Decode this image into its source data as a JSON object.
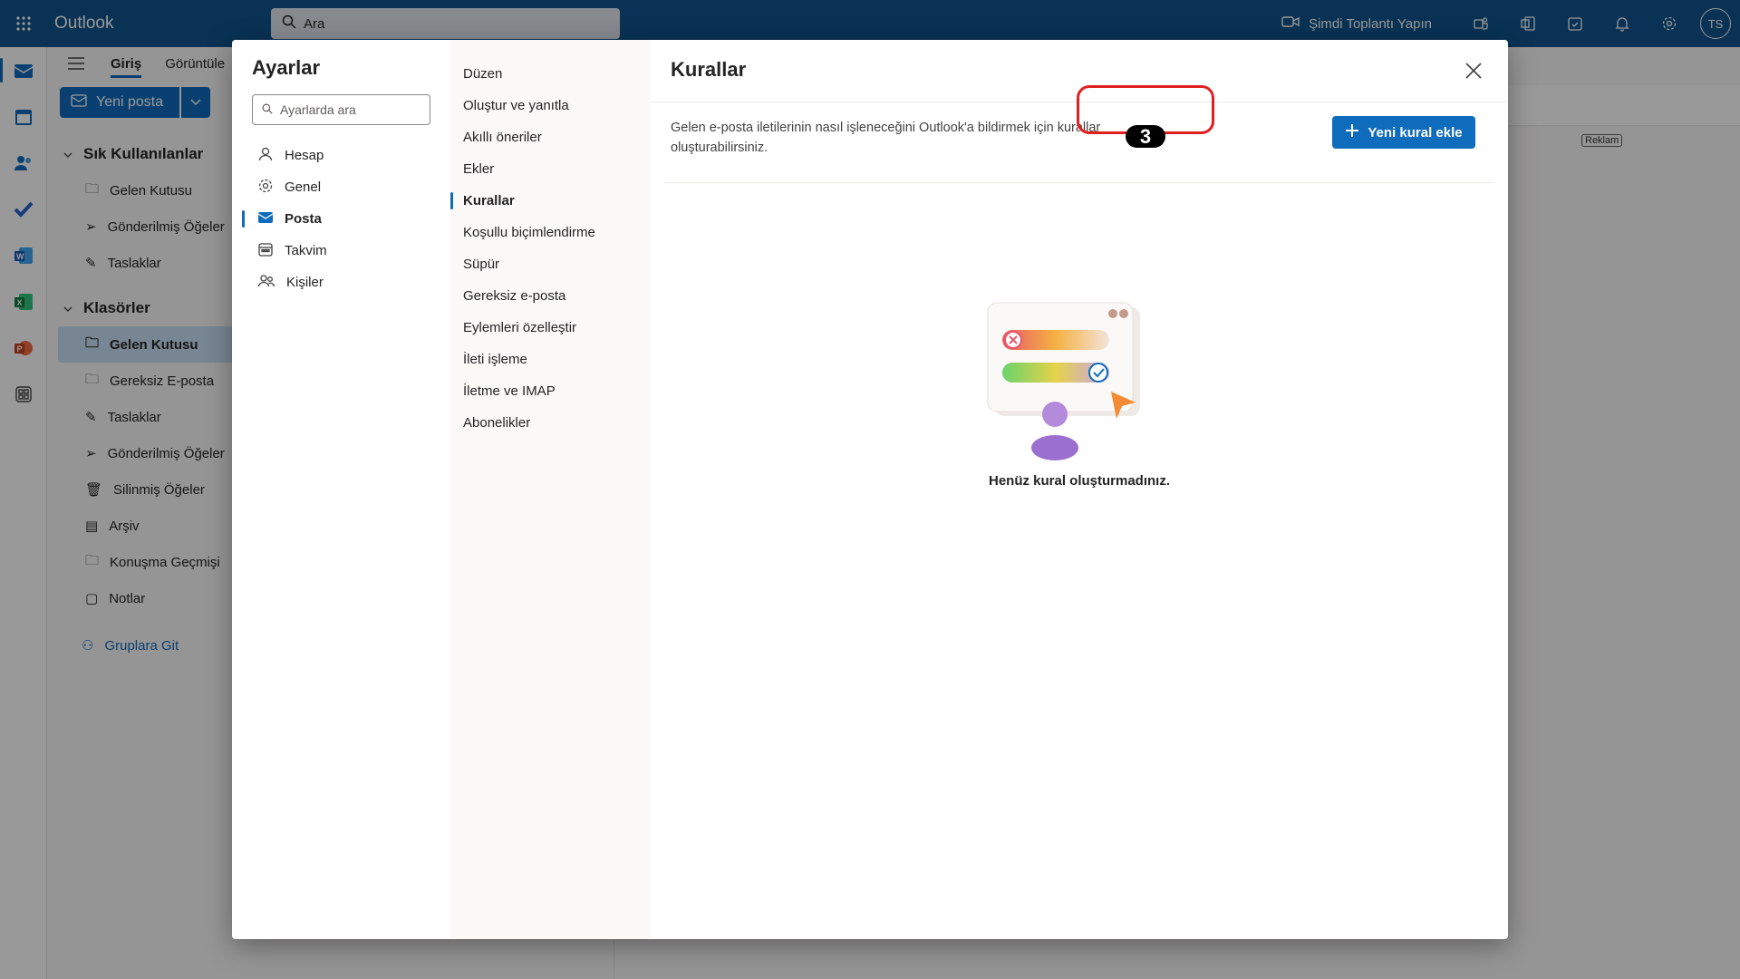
{
  "app": {
    "name": "Outlook"
  },
  "search": {
    "placeholder": "Ara"
  },
  "topbar": {
    "meet_now": "Şimdi Toplantı Yapın",
    "avatar_initials": "TS"
  },
  "ribbon": {
    "tabs": [
      "Giriş",
      "Görüntüle"
    ],
    "new_mail": "Yeni posta",
    "ad_label": "Reklam"
  },
  "folders": {
    "favorites_title": "Sık Kullanılanlar",
    "favorites": [
      "Gelen Kutusu",
      "Gönderilmiş Öğeler",
      "Taslaklar"
    ],
    "folders_title": "Klasörler",
    "items": [
      "Gelen Kutusu",
      "Gereksiz E-posta",
      "Taslaklar",
      "Gönderilmiş Öğeler",
      "Silinmiş Öğeler",
      "Arşiv",
      "Konuşma Geçmişi",
      "Notlar"
    ],
    "groups_link": "Gruplara Git"
  },
  "settings": {
    "title": "Ayarlar",
    "search_placeholder": "Ayarlarda ara",
    "categories": [
      "Hesap",
      "Genel",
      "Posta",
      "Takvim",
      "Kişiler"
    ],
    "active_category": "Posta",
    "mail_sections": [
      "Düzen",
      "Oluştur ve yanıtla",
      "Akıllı öneriler",
      "Ekler",
      "Kurallar",
      "Koşullu biçimlendirme",
      "Süpür",
      "Gereksiz e-posta",
      "Eylemleri özelleştir",
      "İleti işleme",
      "İletme ve IMAP",
      "Abonelikler"
    ],
    "active_section": "Kurallar"
  },
  "rules": {
    "title": "Kurallar",
    "description": "Gelen e-posta iletilerinin nasıl işleneceğini Outlook'a bildirmek için kurallar oluşturabilirsiniz.",
    "add_button": "Yeni kural ekle",
    "empty_state": "Henüz kural oluşturmadınız.",
    "step_badge": "3"
  },
  "colors": {
    "brand": "#0f548c",
    "accent": "#0f6cbd",
    "highlight": "#e02020"
  }
}
